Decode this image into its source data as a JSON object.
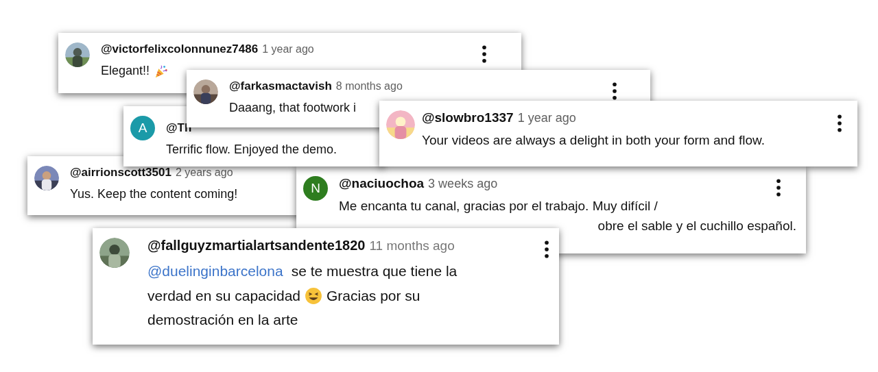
{
  "comments": [
    {
      "handle": "@victorfelixcolonnunez7486",
      "time": "1 year ago",
      "avatar": {
        "kind": "picture"
      },
      "menu": true,
      "lines": [
        [
          {
            "kind": "text",
            "text": "Elegant!!"
          },
          {
            "kind": "party"
          }
        ]
      ]
    },
    {
      "handle": "@farkasmactavish",
      "time": "8 months ago",
      "avatar": {
        "kind": "picture"
      },
      "menu": true,
      "lines": [
        [
          {
            "kind": "text",
            "text": "Daaang, that footwork i"
          }
        ]
      ]
    },
    {
      "handle": "@Th",
      "avatar": {
        "kind": "letter",
        "letter": "A",
        "color": "#1b9aa8"
      },
      "menu": false,
      "lines": [
        [
          {
            "kind": "text",
            "text": "Terrific flow. Enjoyed the demo."
          }
        ]
      ]
    },
    {
      "handle": "@slowbro1337",
      "time": "1 year ago",
      "avatar": {
        "kind": "picture"
      },
      "menu": true,
      "lines": [
        [
          {
            "kind": "text",
            "text": "Your videos are always a delight in both your form and flow."
          }
        ]
      ]
    },
    {
      "handle": "@airrionscott3501",
      "time": "2 years ago",
      "avatar": {
        "kind": "picture"
      },
      "menu": false,
      "lines": [
        [
          {
            "kind": "text",
            "text": "Yus. Keep the content coming!"
          }
        ]
      ]
    },
    {
      "handle": "@naciuochoa",
      "time": "3 weeks ago",
      "avatar": {
        "kind": "letter",
        "letter": "N",
        "color": "#2e7d1f"
      },
      "menu": true,
      "lines": [
        [
          {
            "kind": "text",
            "text": "Me encanta tu canal, gracias por el trabajo. Muy difícil /"
          }
        ],
        [
          {
            "kind": "text",
            "text": "obre el sable y el cuchillo español."
          }
        ]
      ]
    },
    {
      "handle": "@fallguyzmartialartsandente1820",
      "time": "11 months ago",
      "avatar": {
        "kind": "picture"
      },
      "menu": true,
      "lines": [
        [
          {
            "kind": "mention",
            "text": "@duelinginbarcelona"
          },
          {
            "kind": "text",
            "text": "se te muestra que tiene la"
          }
        ],
        [
          {
            "kind": "text",
            "text": "verdad en su capacidad"
          },
          {
            "kind": "grin"
          },
          {
            "kind": "text",
            "text": "Gracias por su"
          }
        ],
        [
          {
            "kind": "text",
            "text": "demostración en la arte"
          }
        ]
      ]
    }
  ]
}
